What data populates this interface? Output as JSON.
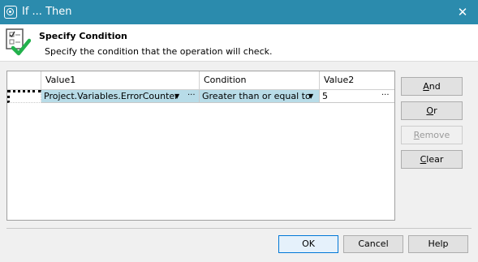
{
  "window": {
    "title": "If ... Then",
    "close_glyph": "✕"
  },
  "header": {
    "title": "Specify Condition",
    "subtitle": "Specify the condition that the operation will check."
  },
  "grid": {
    "columns": [
      "",
      "Value1",
      "Condition",
      "Value2"
    ],
    "rows": [
      {
        "value1": "Project.Variables.ErrorCounter",
        "condition": "Greater than or equal to",
        "value2": "5"
      }
    ],
    "dropdown_glyph": "▼",
    "ellipsis_glyph": "···"
  },
  "side_buttons": {
    "and": {
      "accel": "A",
      "rest": "nd",
      "disabled": false
    },
    "or": {
      "accel": "O",
      "rest": "r",
      "disabled": false
    },
    "remove": {
      "accel": "R",
      "rest": "emove",
      "disabled": true
    },
    "clear": {
      "accel": "C",
      "rest": "lear",
      "disabled": false
    }
  },
  "footer": {
    "ok": "OK",
    "cancel": "Cancel",
    "help": "Help"
  },
  "colors": {
    "titlebar": "#2b8bad",
    "selection": "#b8dce8",
    "check_green": "#22b14c"
  },
  "icons": {
    "app": "app-logo-icon",
    "header": "checklist-checkmark-icon",
    "close": "close-icon"
  }
}
